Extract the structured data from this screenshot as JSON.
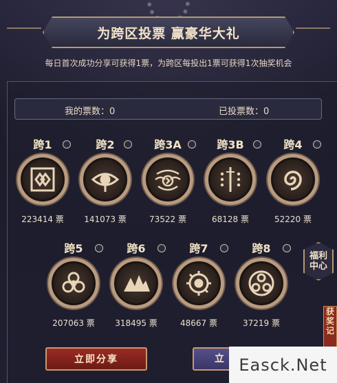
{
  "header": {
    "title": "为跨区投票 赢豪华大礼",
    "subtitle": "每日首次成功分享可获得1票，为跨区每投出1票可获得1次抽奖机会"
  },
  "counters": {
    "my_votes": "我的票数：0",
    "voted": "已投票数：0"
  },
  "servers_row1": [
    {
      "name": "跨1",
      "votes": "223414 票",
      "icon": "double-diamond-icon"
    },
    {
      "name": "跨2",
      "votes": "141073 票",
      "icon": "eye-icon"
    },
    {
      "name": "跨3A",
      "votes": "73522 票",
      "icon": "tentacle-eye-icon"
    },
    {
      "name": "跨3B",
      "votes": "68128 票",
      "icon": "sword-dots-icon"
    },
    {
      "name": "跨4",
      "votes": "52220 票",
      "icon": "spiral-icon"
    }
  ],
  "servers_row2": [
    {
      "name": "跨5",
      "votes": "207063 票",
      "icon": "biohazard-icon"
    },
    {
      "name": "跨6",
      "votes": "318495 票",
      "icon": "mountain-icon"
    },
    {
      "name": "跨7",
      "votes": "48667 票",
      "icon": "flame-eye-icon"
    },
    {
      "name": "跨8",
      "votes": "37219 票",
      "icon": "triple-orb-icon"
    }
  ],
  "side": {
    "welfare": "福利中心",
    "prize": "获奖记"
  },
  "buttons": {
    "share": "立即分享",
    "vote": "立"
  },
  "watermark": "Easck.Net"
}
